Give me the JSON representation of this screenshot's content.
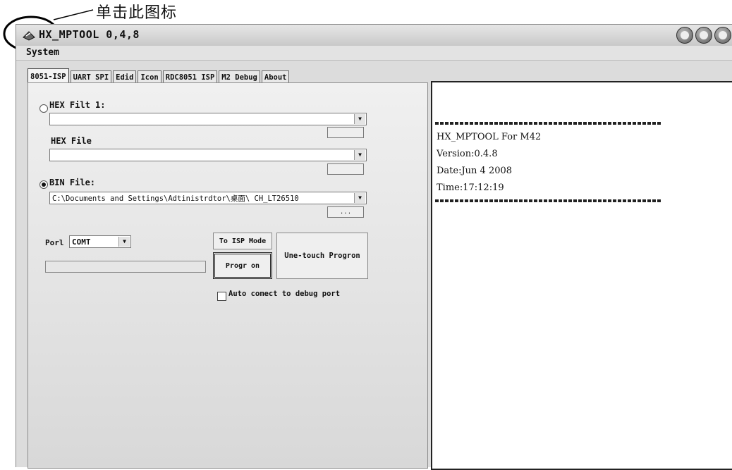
{
  "annotation": {
    "text": "单击此图标"
  },
  "window": {
    "title": "HX_MPTOOL 0,4,8",
    "controls": [
      "minimize-icon",
      "maximize-icon",
      "close-icon"
    ]
  },
  "menu": {
    "system": "System"
  },
  "tabs": [
    {
      "label": "8051-ISP",
      "active": true
    },
    {
      "label": "UART SPI",
      "active": false
    },
    {
      "label": "Edid",
      "active": false
    },
    {
      "label": "Icon",
      "active": false
    },
    {
      "label": "RDC8051 ISP",
      "active": false
    },
    {
      "label": "M2 Debug",
      "active": false
    },
    {
      "label": "About",
      "active": false
    }
  ],
  "isp": {
    "hex_file1_label": "HEX Filt 1:",
    "hex_file1_value": "",
    "hex_file1_selected": false,
    "hex_file_label": "HEX File",
    "hex_file_value": "",
    "bin_file_label": "BIN File:",
    "bin_file_value": "C:\\Documents and Settings\\Adtinistrdtor\\桌面\\ CH_LT26510",
    "bin_file_selected": true,
    "browse_label": "...",
    "port_label": "Porl",
    "port_value": "COMT",
    "to_isp_mode_label": "To ISP Mode",
    "program_label": "Progr on",
    "one_touch_label": "Une-touch Progron",
    "auto_connect_label": "Auto comect to debug port",
    "auto_connect_checked": false,
    "progress": 0
  },
  "log": {
    "lines": [
      "HX_MPTOOL For M42",
      "Version:0.4.8",
      "Date:Jun 4 2008",
      "Time:17:12:19"
    ]
  }
}
